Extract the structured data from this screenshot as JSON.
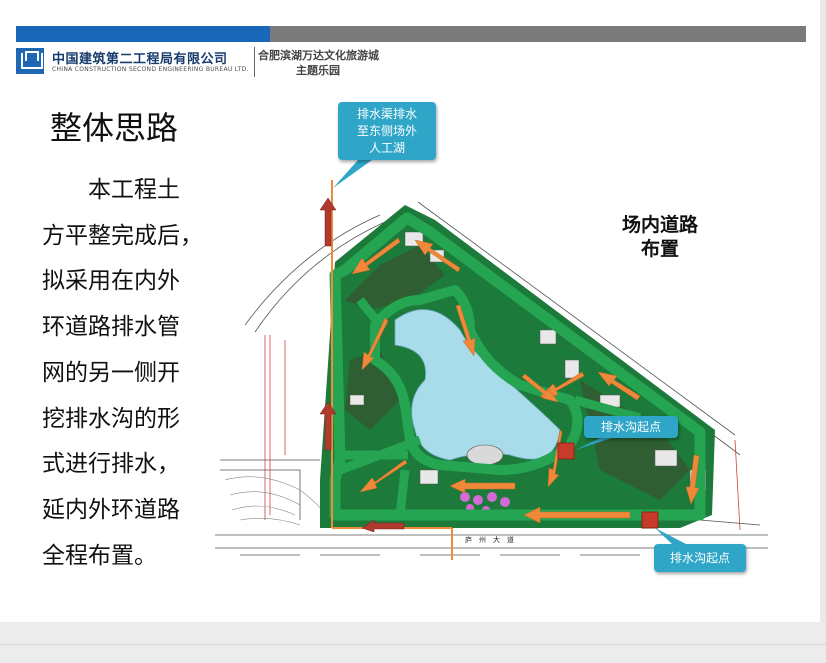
{
  "header": {
    "company_cn": "中国建筑第二工程局有限公司",
    "company_en": "CHINA CONSTRUCTION SECOND ENGINEERING BUREAU LTD.",
    "project_line1": "合肥滨湖万达文化旅游城",
    "project_line2": "主题乐园"
  },
  "slide": {
    "title": "整体思路",
    "body_lines": [
      "　　本工程土",
      "方平整完成后，",
      "拟采用在内外",
      "环道路排水管",
      "网的另一侧开",
      "挖排水沟的形",
      "式进行排水，",
      "延内外环道路",
      "全程布置。"
    ]
  },
  "map": {
    "callout_top_line1": "排水渠排水",
    "callout_top_line2": "至东侧场外",
    "callout_top_line3": "人工湖",
    "callout_mid": "排水沟起点",
    "callout_bottom": "排水沟起点",
    "road_label_line1": "场内道路",
    "road_label_line2": "布置",
    "street_label": "庐　州　大　道",
    "colors": {
      "road_green": "#25a552",
      "lake": "#a9dcea",
      "arrow": "#f0883a",
      "callout": "#2fa6c8",
      "pipe": "#f08a3c",
      "marker": "#c83a2a"
    }
  }
}
